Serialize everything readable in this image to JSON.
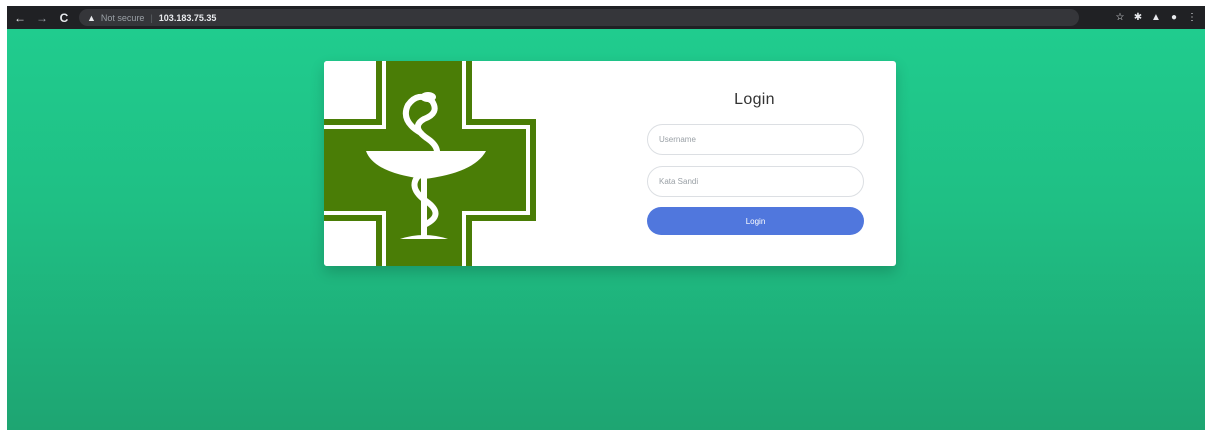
{
  "browser": {
    "back_icon": "arrow-left",
    "forward_icon": "arrow-right",
    "reload_icon": "reload",
    "security_text": "Not secure",
    "url": "103.183.75.35",
    "right_icons": [
      "star-icon",
      "extension-icon",
      "lab-icon",
      "profile-icon",
      "menu-icon"
    ]
  },
  "page": {
    "background_top": "#20cc8e",
    "background_bottom": "#1ea572"
  },
  "logo": {
    "cross_color": "#4a7d06",
    "symbol": "bowl-of-hygieia"
  },
  "login": {
    "title": "Login",
    "username_placeholder": "Username",
    "password_placeholder": "Kata Sandi",
    "submit_label": "Login",
    "button_color": "#5077dd"
  }
}
